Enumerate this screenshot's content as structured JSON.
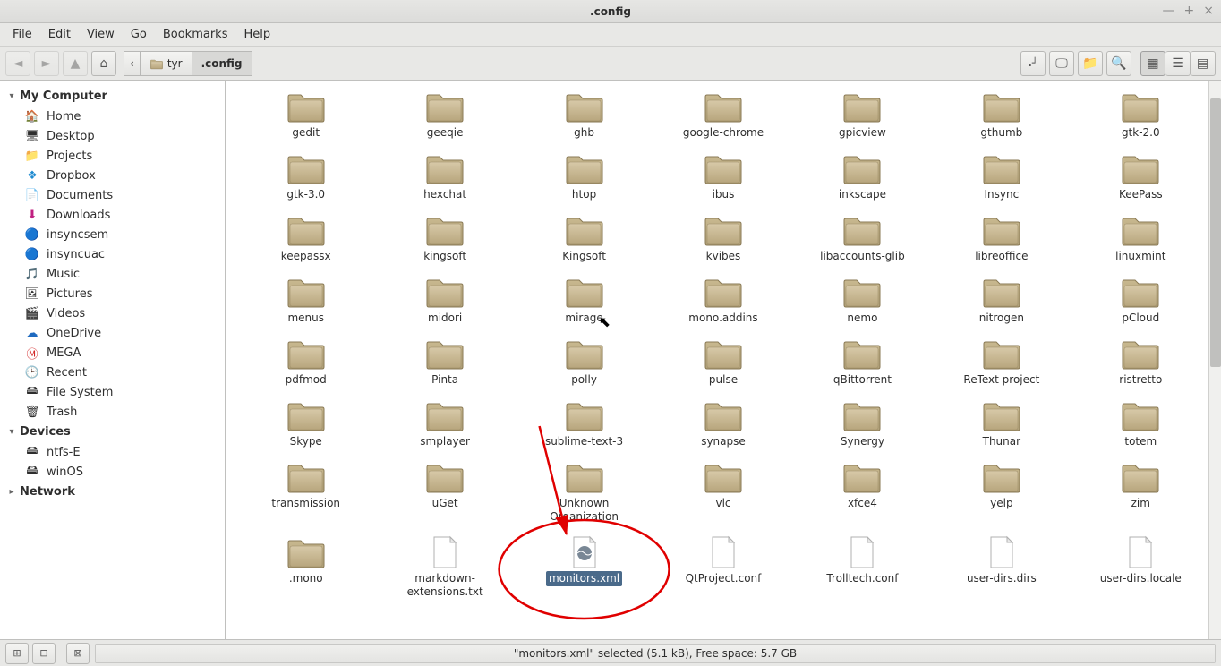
{
  "window": {
    "title": ".config"
  },
  "menubar": [
    "File",
    "Edit",
    "View",
    "Go",
    "Bookmarks",
    "Help"
  ],
  "path": {
    "segments": [
      "tyr",
      ".config"
    ],
    "current": ".config"
  },
  "sidebar": {
    "sections": [
      {
        "title": "My Computer",
        "expanded": true,
        "items": [
          {
            "label": "Home",
            "icon": "home"
          },
          {
            "label": "Desktop",
            "icon": "desktop"
          },
          {
            "label": "Projects",
            "icon": "folder"
          },
          {
            "label": "Dropbox",
            "icon": "dropbox"
          },
          {
            "label": "Documents",
            "icon": "documents"
          },
          {
            "label": "Downloads",
            "icon": "downloads"
          },
          {
            "label": "insyncsem",
            "icon": "insync"
          },
          {
            "label": "insyncuac",
            "icon": "insync"
          },
          {
            "label": "Music",
            "icon": "music"
          },
          {
            "label": "Pictures",
            "icon": "pictures"
          },
          {
            "label": "Videos",
            "icon": "videos"
          },
          {
            "label": "OneDrive",
            "icon": "onedrive"
          },
          {
            "label": "MEGA",
            "icon": "mega"
          },
          {
            "label": "Recent",
            "icon": "recent"
          },
          {
            "label": "File System",
            "icon": "drive"
          },
          {
            "label": "Trash",
            "icon": "trash"
          }
        ]
      },
      {
        "title": "Devices",
        "expanded": true,
        "items": [
          {
            "label": "ntfs-E",
            "icon": "drive"
          },
          {
            "label": "winOS",
            "icon": "drive"
          }
        ]
      },
      {
        "title": "Network",
        "expanded": false,
        "items": []
      }
    ]
  },
  "items": [
    {
      "name": "gedit",
      "type": "folder"
    },
    {
      "name": "geeqie",
      "type": "folder"
    },
    {
      "name": "ghb",
      "type": "folder"
    },
    {
      "name": "google-chrome",
      "type": "folder"
    },
    {
      "name": "gpicview",
      "type": "folder"
    },
    {
      "name": "gthumb",
      "type": "folder"
    },
    {
      "name": "gtk-2.0",
      "type": "folder"
    },
    {
      "name": "gtk-3.0",
      "type": "folder"
    },
    {
      "name": "hexchat",
      "type": "folder"
    },
    {
      "name": "htop",
      "type": "folder"
    },
    {
      "name": "ibus",
      "type": "folder"
    },
    {
      "name": "inkscape",
      "type": "folder"
    },
    {
      "name": "Insync",
      "type": "folder"
    },
    {
      "name": "KeePass",
      "type": "folder"
    },
    {
      "name": "keepassx",
      "type": "folder"
    },
    {
      "name": "kingsoft",
      "type": "folder"
    },
    {
      "name": "Kingsoft",
      "type": "folder"
    },
    {
      "name": "kvibes",
      "type": "folder"
    },
    {
      "name": "libaccounts-glib",
      "type": "folder"
    },
    {
      "name": "libreoffice",
      "type": "folder"
    },
    {
      "name": "linuxmint",
      "type": "folder"
    },
    {
      "name": "menus",
      "type": "folder"
    },
    {
      "name": "midori",
      "type": "folder"
    },
    {
      "name": "mirage",
      "type": "folder"
    },
    {
      "name": "mono.addins",
      "type": "folder"
    },
    {
      "name": "nemo",
      "type": "folder"
    },
    {
      "name": "nitrogen",
      "type": "folder"
    },
    {
      "name": "pCloud",
      "type": "folder"
    },
    {
      "name": "pdfmod",
      "type": "folder"
    },
    {
      "name": "Pinta",
      "type": "folder"
    },
    {
      "name": "polly",
      "type": "folder"
    },
    {
      "name": "pulse",
      "type": "folder"
    },
    {
      "name": "qBittorrent",
      "type": "folder"
    },
    {
      "name": "ReText project",
      "type": "folder"
    },
    {
      "name": "ristretto",
      "type": "folder"
    },
    {
      "name": "Skype",
      "type": "folder"
    },
    {
      "name": "smplayer",
      "type": "folder"
    },
    {
      "name": "sublime-text-3",
      "type": "folder"
    },
    {
      "name": "synapse",
      "type": "folder"
    },
    {
      "name": "Synergy",
      "type": "folder"
    },
    {
      "name": "Thunar",
      "type": "folder"
    },
    {
      "name": "totem",
      "type": "folder"
    },
    {
      "name": "transmission",
      "type": "folder"
    },
    {
      "name": "uGet",
      "type": "folder"
    },
    {
      "name": "Unknown Organization",
      "type": "folder"
    },
    {
      "name": "vlc",
      "type": "folder"
    },
    {
      "name": "xfce4",
      "type": "folder"
    },
    {
      "name": "yelp",
      "type": "folder"
    },
    {
      "name": "zim",
      "type": "folder"
    },
    {
      "name": ".mono",
      "type": "folder"
    },
    {
      "name": "markdown-extensions.txt",
      "type": "text"
    },
    {
      "name": "monitors.xml",
      "type": "xml",
      "selected": true
    },
    {
      "name": "QtProject.conf",
      "type": "text"
    },
    {
      "name": "Trolltech.conf",
      "type": "text"
    },
    {
      "name": "user-dirs.dirs",
      "type": "text"
    },
    {
      "name": "user-dirs.locale",
      "type": "text"
    }
  ],
  "statusbar": {
    "text": "\"monitors.xml\" selected (5.1 kB), Free space: 5.7 GB"
  },
  "annotation": {
    "highlight_item": "monitors.xml"
  }
}
